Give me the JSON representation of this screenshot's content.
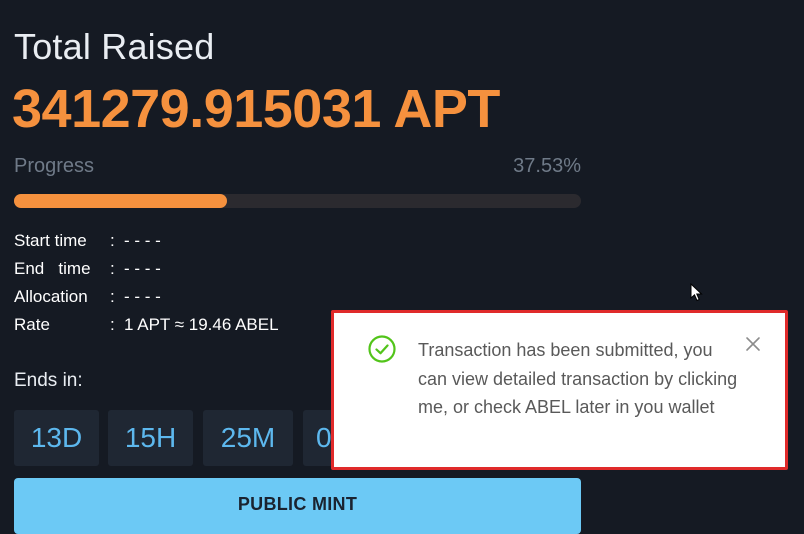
{
  "raise": {
    "title": "Total Raised",
    "amount": "341279.915031 APT",
    "progress_label": "Progress",
    "progress_percent": "37.53%",
    "progress_value": 0.3753
  },
  "info": {
    "start_label": "Start time",
    "start_value": "- - - -",
    "end_label": "End   time",
    "end_value": "- - - -",
    "allocation_label": "Allocation",
    "allocation_value": "- - - -",
    "rate_label": "Rate",
    "rate_value": "1 APT ≈ 19.46 ABEL",
    "separator": ":"
  },
  "countdown": {
    "label": "Ends in:",
    "days": "13D",
    "hours": "15H",
    "minutes": "25M",
    "seconds": "0"
  },
  "mint_button": {
    "label": "PUBLIC MINT"
  },
  "toast": {
    "message": "Transaction has been submitted, you can view detailed transaction by clicking me, or check ABEL later in you wallet",
    "icon": "check-circle-icon",
    "close_icon": "close-icon"
  },
  "colors": {
    "background": "#151a23",
    "accent": "#f5913e",
    "button": "#6cc9f5",
    "countdown_text": "#5db8ee",
    "toast_border": "#e02a2a",
    "success": "#52c41a"
  }
}
